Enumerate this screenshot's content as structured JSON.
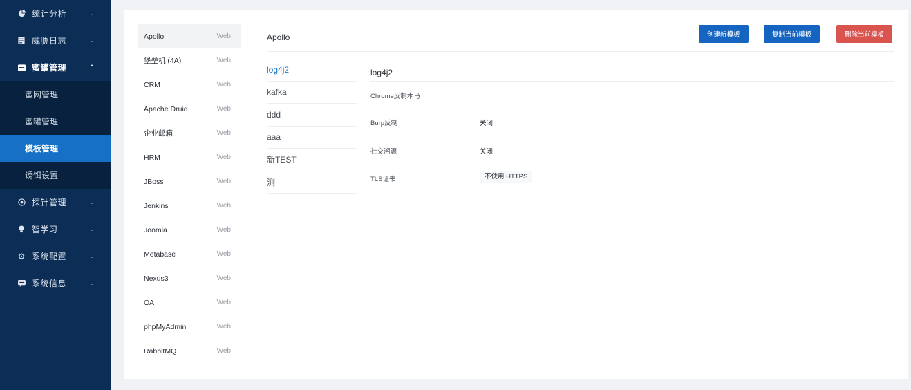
{
  "sidebar": {
    "items": [
      {
        "label": "统计分析",
        "icon": "pie-chart-icon",
        "open": false
      },
      {
        "label": "威胁日志",
        "icon": "log-icon",
        "open": false
      },
      {
        "label": "蜜罐管理",
        "icon": "honeypot-icon",
        "open": true
      }
    ],
    "sub_items": [
      {
        "label": "蜜网管理"
      },
      {
        "label": "蜜罐管理"
      },
      {
        "label": "模板管理",
        "active": true
      },
      {
        "label": "诱饵设置"
      }
    ],
    "items_after": [
      {
        "label": "探针管理",
        "icon": "probe-icon"
      },
      {
        "label": "智学习",
        "icon": "bulb-icon"
      },
      {
        "label": "系统配置",
        "icon": "gear-icon"
      },
      {
        "label": "系统信息",
        "icon": "message-icon"
      }
    ]
  },
  "templates": [
    {
      "name": "Apollo",
      "type": "Web",
      "selected": true
    },
    {
      "name": "堡垒机 (4A)",
      "type": "Web"
    },
    {
      "name": "CRM",
      "type": "Web"
    },
    {
      "name": "Apache Druid",
      "type": "Web"
    },
    {
      "name": "企业邮箱",
      "type": "Web"
    },
    {
      "name": "HRM",
      "type": "Web"
    },
    {
      "name": "JBoss",
      "type": "Web"
    },
    {
      "name": "Jenkins",
      "type": "Web"
    },
    {
      "name": "Joomla",
      "type": "Web"
    },
    {
      "name": "Metabase",
      "type": "Web"
    },
    {
      "name": "Nexus3",
      "type": "Web"
    },
    {
      "name": "OA",
      "type": "Web"
    },
    {
      "name": "phpMyAdmin",
      "type": "Web"
    },
    {
      "name": "RabbitMQ",
      "type": "Web"
    }
  ],
  "detail": {
    "title": "Apollo",
    "buttons": {
      "create": "创建新模板",
      "copy": "复制当前模板",
      "delete": "删除当前模板"
    },
    "sub_templates": [
      {
        "name": "log4j2",
        "selected": true
      },
      {
        "name": "kafka"
      },
      {
        "name": "ddd"
      },
      {
        "name": "aaa"
      },
      {
        "name": "新TEST"
      },
      {
        "name": "测"
      }
    ],
    "props_title": "log4j2",
    "props": {
      "chrome": {
        "label": "Chrome反制木马",
        "value": ""
      },
      "burp": {
        "label": "Burp反制",
        "value": "关闭"
      },
      "social": {
        "label": "社交溯源",
        "value": "关闭"
      },
      "tls": {
        "label": "TLS证书",
        "value": "不使用 HTTPS"
      }
    }
  },
  "colors": {
    "sidebar_bg": "#0c2d55",
    "active_blue": "#1570c6",
    "button_blue": "#1565c0",
    "button_red": "#d9534f"
  }
}
